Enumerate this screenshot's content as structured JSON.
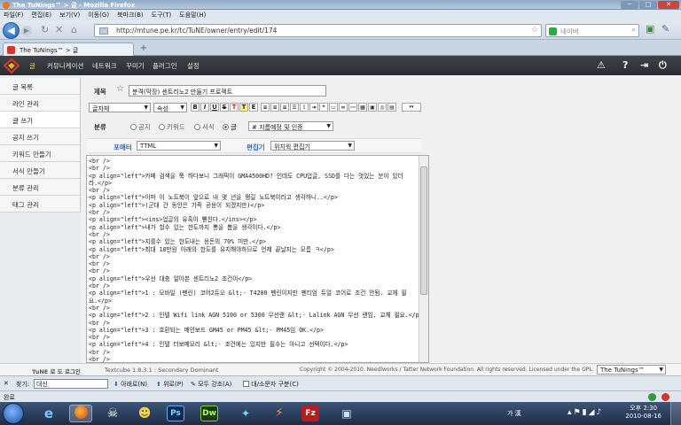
{
  "window": {
    "title": "The TuNings™ > 글 - Mozilla Firefox"
  },
  "menubar": [
    "파일(F)",
    "편집(E)",
    "보기(V)",
    "이동(G)",
    "북마크(B)",
    "도구(T)",
    "도움말(H)"
  ],
  "nav": {
    "url": "http://mtune.pe.kr/tc/TuNE/owner/entry/edit/174",
    "search_placeholder": "네이버"
  },
  "tab": {
    "label": "The TuNings™ > 글",
    "new_tab": "+"
  },
  "appbar": {
    "items": [
      "글",
      "커뮤니케이션",
      "네트워크",
      "꾸미기",
      "플러그인",
      "설정"
    ]
  },
  "sidebar": {
    "items": [
      "글 목록",
      "라인 관리",
      "글 쓰기",
      "공지 쓰기",
      "키워드 만들기",
      "서식 만들기",
      "분류 관리",
      "태그 관리"
    ],
    "active_index": 2
  },
  "editor": {
    "title_label": "제목",
    "title_value": "분격(막장) 센트리노2 만들기 프로젝트",
    "font_select": "글자체",
    "size_select": "속성",
    "format_buttons": [
      "B",
      "I",
      "U",
      "S",
      "T",
      "T",
      "E"
    ],
    "category_label": "분류",
    "category_options": [
      "공지",
      "키워드",
      "서식",
      "글"
    ],
    "category_selected": "글",
    "category_select": "# 지름예정 및 인증",
    "formatter_label": "포매터",
    "formatter_value": "TTML",
    "editor_label": "편집기",
    "editor_value": "위지윅 편집기",
    "lines": [
      "<br />",
      "<br />",
      "<p align=\"left\">카페 검색을 쭉 하다보니 그래픽이 GMA4500HD? 인데도 CPU업글, SSD를 다는 멋있는 분이 있더",
      "라.</p>",
      "<br />",
      "<p align=\"left\">이마 이 노트북이 앞으로 내 몇 년을 쩡길 노트북이라고 생각하니..</p>",
      "<p align=\"left\">(군대 간 동안은 가족 공용이 되겠지만)</p>",
      "<br />",
      "<p align=\"left\"><ins>업글의 유혹이 뻗친다.</ins></p>",
      "<p align=\"left\">내가 할수 있는 한도까지 뽕을 뽑을 생각이다.</p>",
      "<br />",
      "<p align=\"left\">지를수 있는 한도내는 용돈의 70% 미만.</p>",
      "<p align=\"left\">최대 10만원 아래의 한도를 유지해야하므로 언제 끝날지는 모름 ㅋ</p>",
      "<br />",
      "<br />",
      "<br />",
      "<p align=\"left\">우선 대충 알아본 센트리노2 조건이</p>",
      "<br />",
      "<p align=\"left\">1 : 모바일 (펜린) 코어2듀오 &lt;- T4200 펜린이지만 펜티엄 듀얼 코어로 조건 안됨. 교체 필",
      "요.</p>",
      "<br />",
      "<p align=\"left\">2 : 인텔 Wifi link AGN 5100 or 5300 무선랜 &lt;- Lalink AGN 무선 랜임. 교체 필요.</p>",
      "<br />",
      "<p align=\"left\">3 : 호환되는 메인보드 GM45 or PM45 &lt;- PM45임 OK.</p>",
      "<br />",
      "<p align=\"left\">4 : 인텔 터보메모리 &lt;- 조건에는 있지만 필수는 아니고 선택이다.</p>",
      "<br />",
      "<br />"
    ]
  },
  "footer": {
    "left": "TuNE 로 도 로그인",
    "middle": "Textcube 1.8.3.1 : Secondary Dominant",
    "copyright": "Copyright © 2004-2010. Needlworks / Tatter Network Foundation. All rights reserved. Licensed under the GPL.",
    "blog_select": "The TuNings™"
  },
  "findbar": {
    "label": "찾기:",
    "value": "대신",
    "next": "아래로(N)",
    "prev": "위로(P)",
    "highlight": "모두 강조(A)",
    "match_case": "대/소문자 구분(C)"
  },
  "statusbar": {
    "text": "완료"
  },
  "taskbar": {
    "lang": "가 漢",
    "time": "오후 2:30",
    "date": "2010-08-16",
    "apps": [
      "Ps",
      "Dw",
      "Fz"
    ]
  }
}
